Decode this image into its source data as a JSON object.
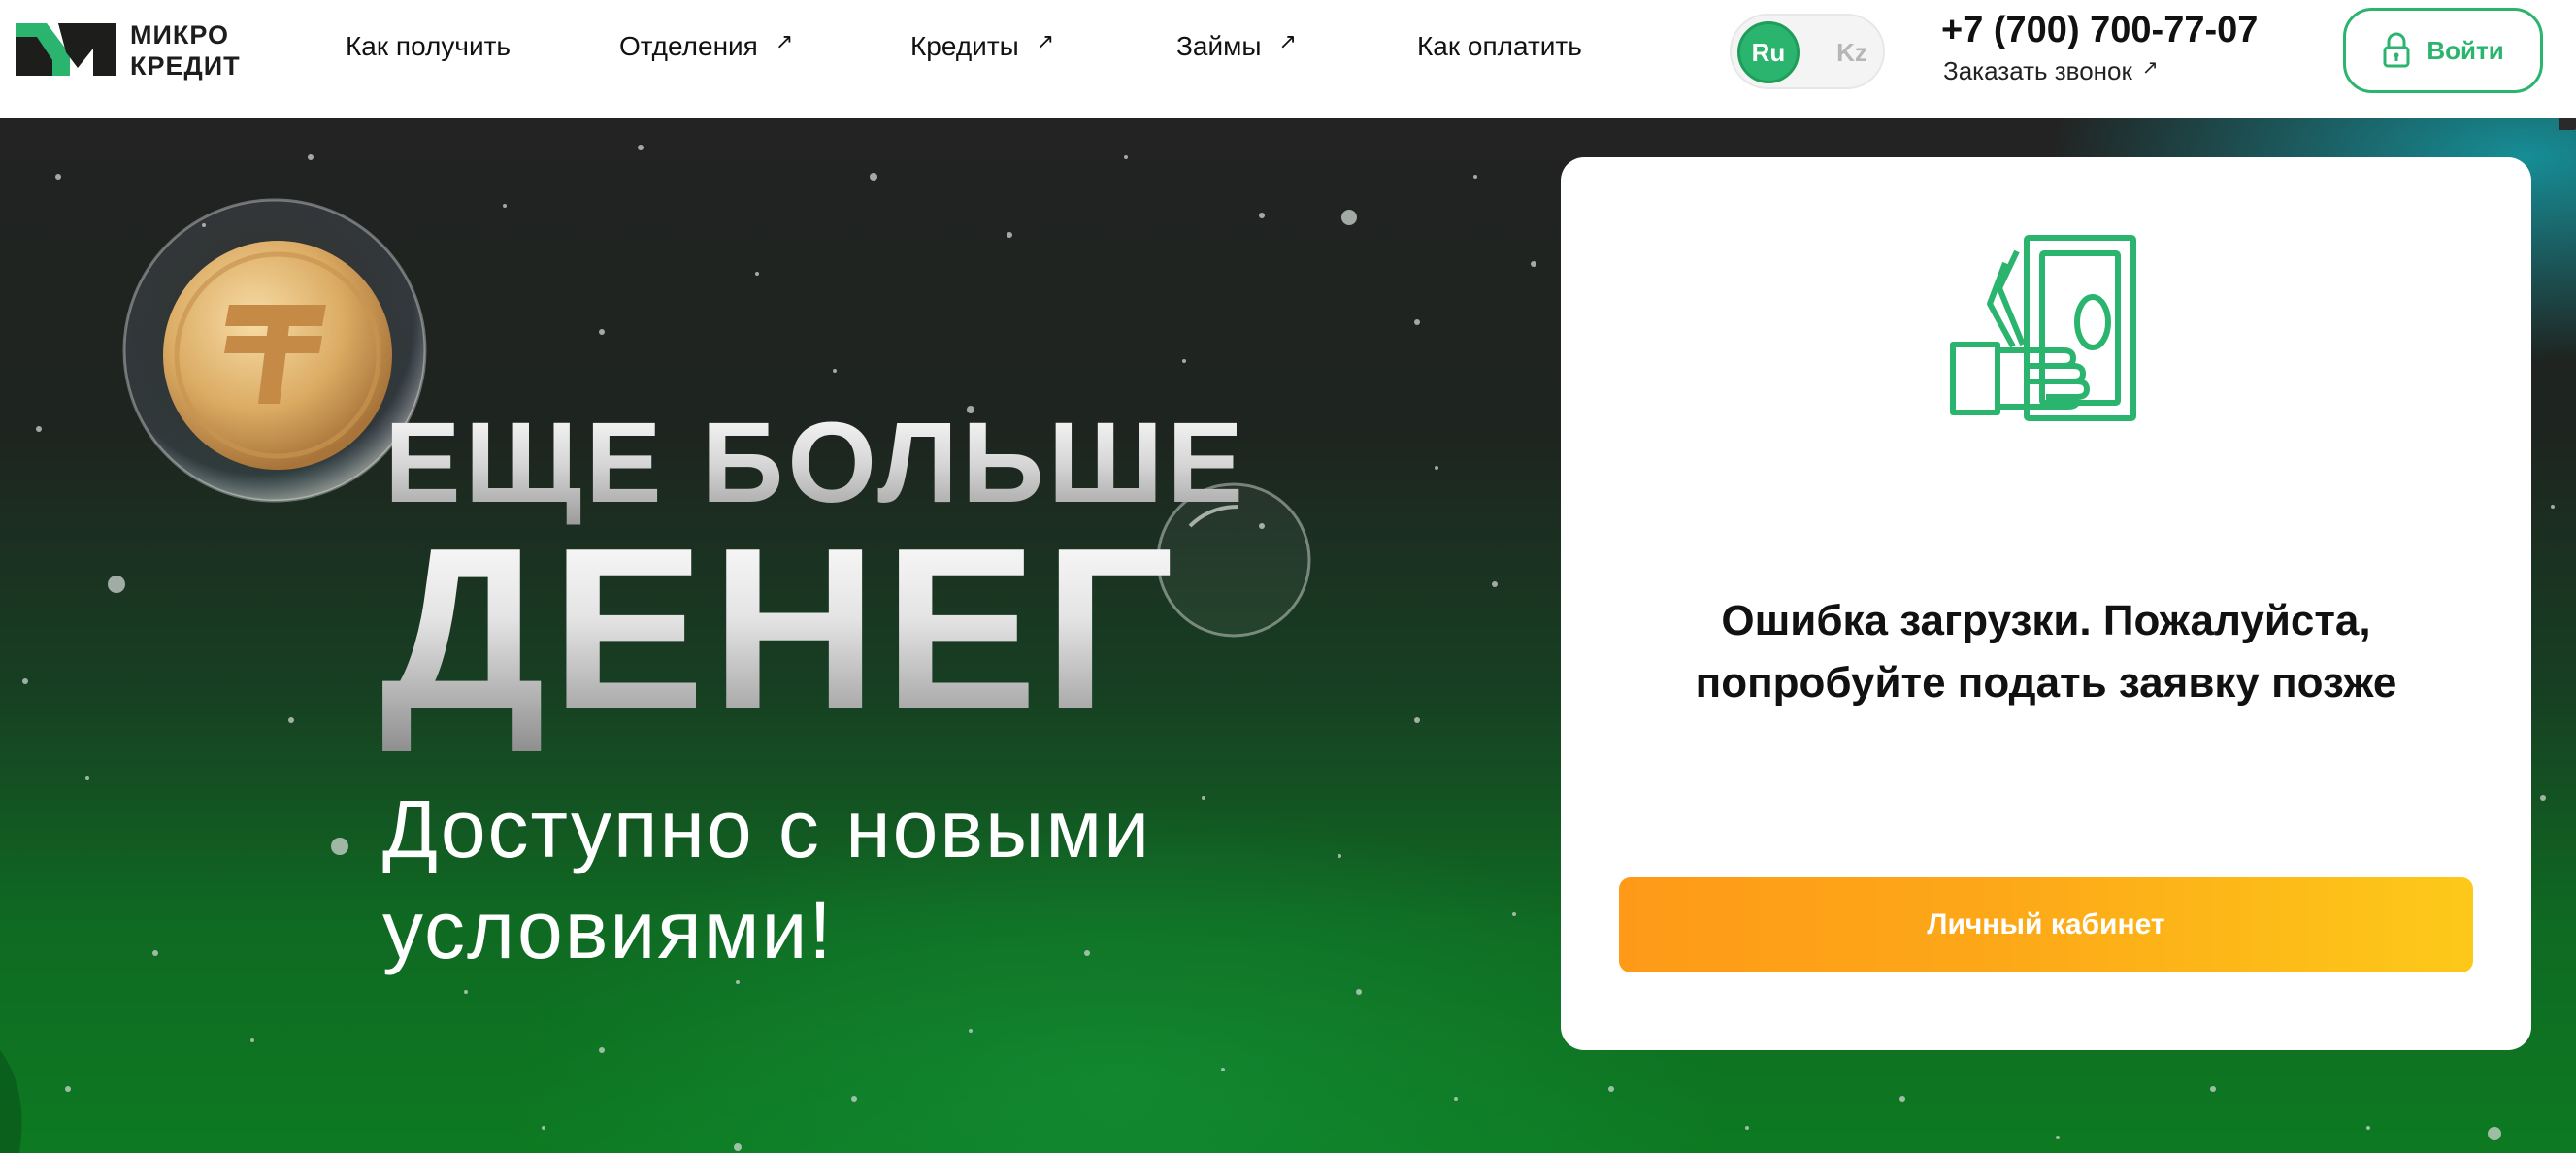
{
  "header": {
    "logo_text_line1": "МИКРО",
    "logo_text_line2": "КРЕДИТ",
    "nav": [
      {
        "label": "Как получить",
        "external": false
      },
      {
        "label": "Отделения",
        "external": true
      },
      {
        "label": "Кредиты",
        "external": true
      },
      {
        "label": "Займы",
        "external": true
      },
      {
        "label": "Как оплатить",
        "external": false
      }
    ],
    "external_arrow": "↗",
    "lang": {
      "active": "Ru",
      "inactive": "Kz"
    },
    "phone": "+7 (700) 700-77-07",
    "callback_label": "Заказать звонок",
    "login_label": "Войти"
  },
  "hero": {
    "line1": "ЕЩЕ БОЛЬШЕ",
    "line2": "ДЕНЕГ",
    "subtitle": "Доступно с новыми условиями!"
  },
  "card": {
    "icon": "hand-with-cash-icon",
    "message": "Ошибка загрузки. Пожалуйста, попробуйте подать заявку позже",
    "button_label": "Личный кабинет"
  },
  "colors": {
    "brand_green": "#2bb46d",
    "button_orange_start": "#fe9a18",
    "button_orange_end": "#fdc919"
  }
}
